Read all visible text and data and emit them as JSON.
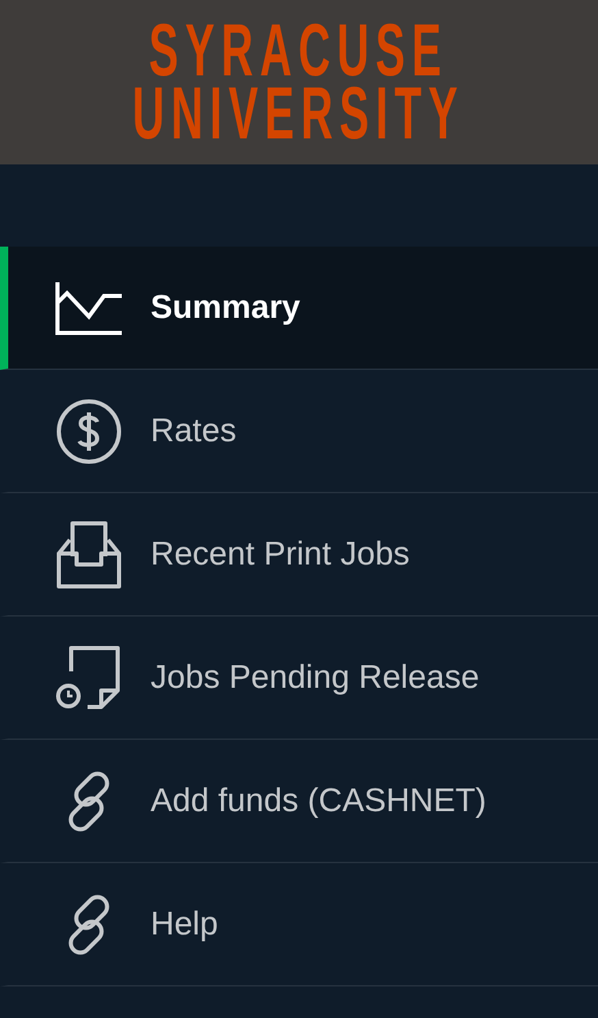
{
  "logo": {
    "lines": [
      "SYRACUSE",
      "UNIVERSITY"
    ]
  },
  "nav": [
    {
      "label": "Summary",
      "kind": "chart",
      "selected": true
    },
    {
      "label": "Rates",
      "kind": "dollar",
      "selected": false
    },
    {
      "label": "Recent Print Jobs",
      "kind": "inbox",
      "selected": false
    },
    {
      "label": "Jobs Pending Release",
      "kind": "pending",
      "selected": false
    },
    {
      "label": "Add funds (CASHNET)",
      "kind": "link",
      "selected": false
    },
    {
      "label": "Help",
      "kind": "link",
      "selected": false
    }
  ]
}
